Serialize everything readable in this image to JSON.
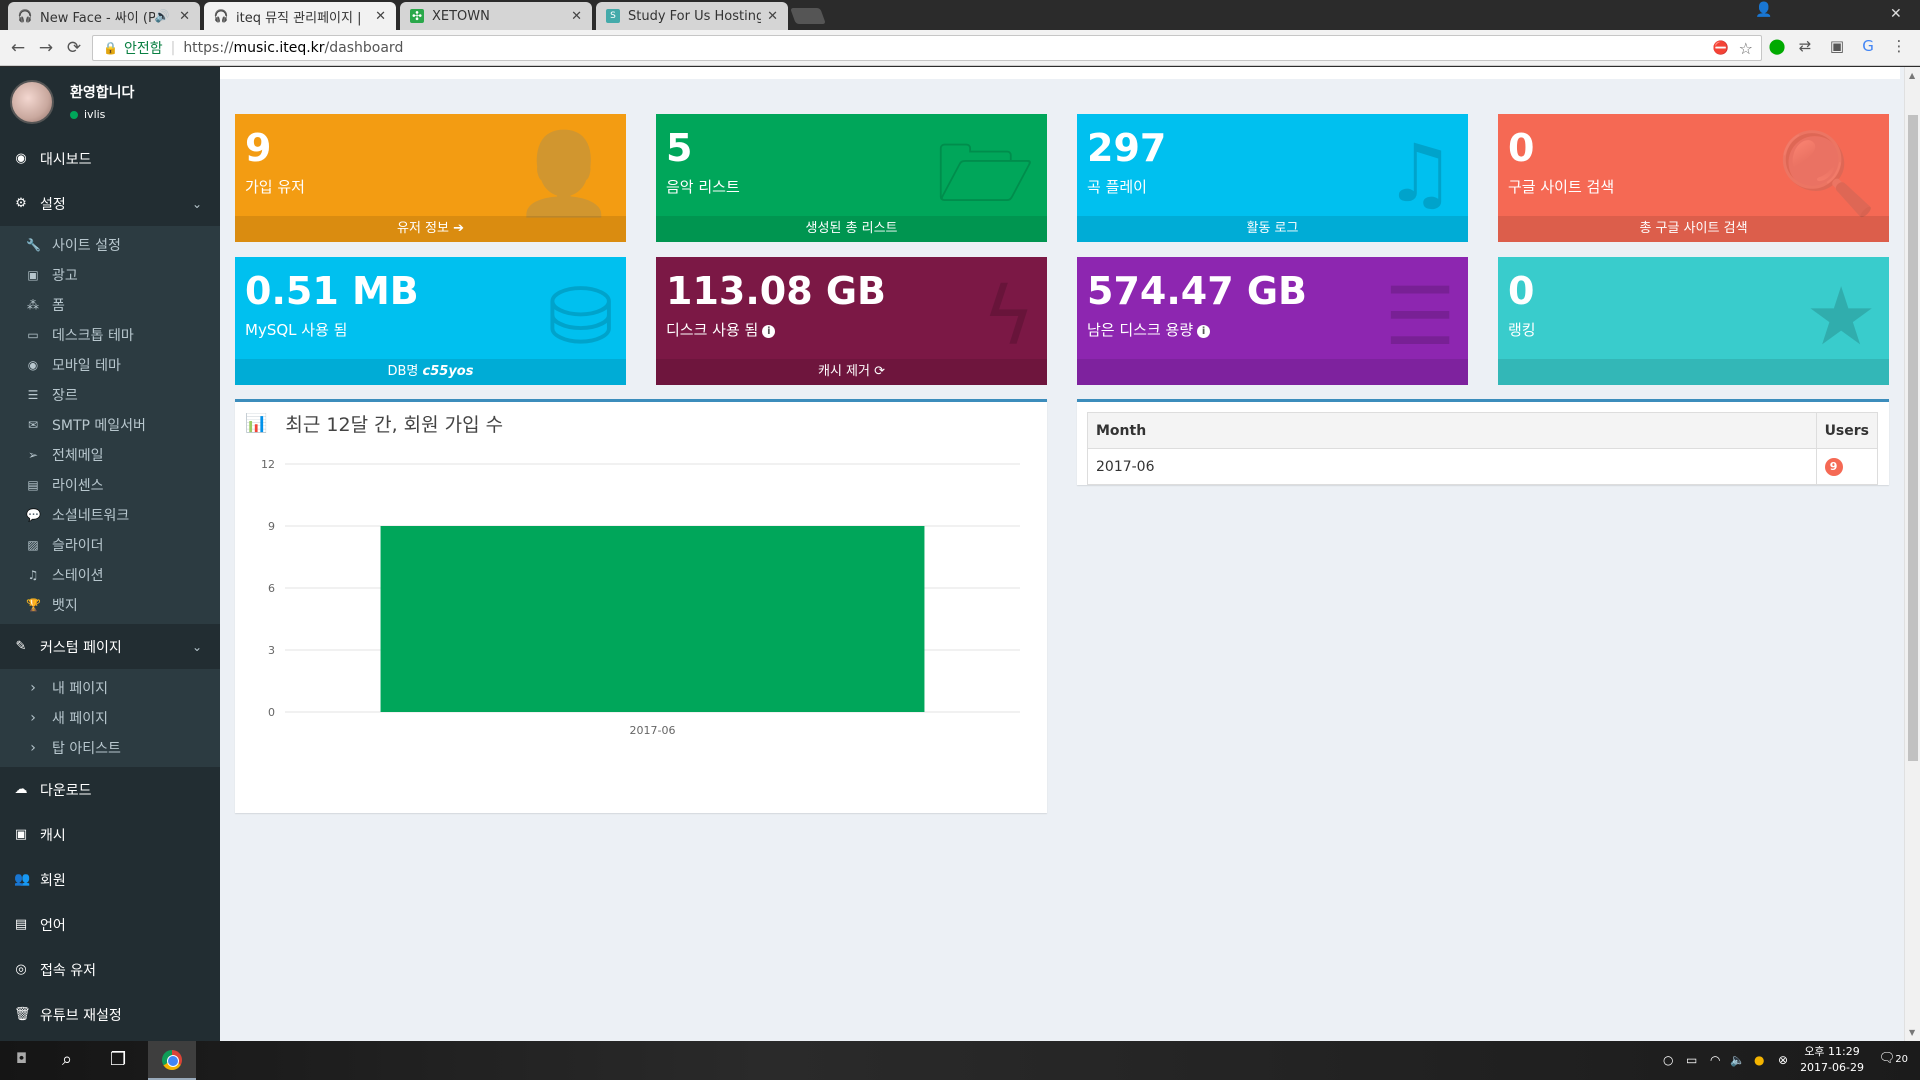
{
  "browser": {
    "tabs": [
      {
        "title": "New Face - 싸이 (PSY)",
        "icon": "headphones-icon"
      },
      {
        "title": "iteq 뮤직 관리페이지 |",
        "icon": "headphones-icon"
      },
      {
        "title": "XETOWN",
        "icon": "xetown-icon"
      },
      {
        "title": "Study For Us Hosting -",
        "icon": "hosting-icon"
      }
    ],
    "secure_label": "안전함",
    "url_scheme": "https://",
    "url_host": "music.iteq.kr",
    "url_path": "/dashboard"
  },
  "user": {
    "name": "환영합니다",
    "status": "ivlis"
  },
  "sidebar": {
    "dashboard": "대시보드",
    "settings": {
      "label": "설정",
      "items": [
        "사이트 설정",
        "광고",
        "폼",
        "데스크톱 테마",
        "모바일 테마",
        "장르",
        "SMTP 메일서버",
        "전체메일",
        "라이센스",
        "소셜네트워크",
        "슬라이더",
        "스테이션",
        "뱃지"
      ]
    },
    "custom_pages": {
      "label": "커스텀 페이지",
      "items": [
        "내 페이지",
        "새 페이지",
        "탑 아티스트"
      ]
    },
    "bottom_items": [
      "다운로드",
      "캐시",
      "회원",
      "언어",
      "접속 유저",
      "유튜브 재설정"
    ]
  },
  "stats": [
    {
      "value": "9",
      "label": "가입 유저",
      "footer": "유저 정보 ➔",
      "color": "#f39c12",
      "icon": "user-plus-icon"
    },
    {
      "value": "5",
      "label": "음악 리스트",
      "footer": "생성된 총 리스트",
      "color": "#00a65a",
      "icon": "folder-open-icon"
    },
    {
      "value": "297",
      "label": "곡 플레이",
      "footer": "활동 로그",
      "color": "#00c0ef",
      "icon": "music-icon"
    },
    {
      "value": "0",
      "label": "구글 사이트 검색",
      "footer": "총 구글 사이트 검색",
      "color": "#f56954",
      "icon": "search-icon"
    },
    {
      "value": "0.51 MB",
      "label": "MySQL 사용 됨",
      "footer_prefix": "DB명",
      "footer_em": "c55yos",
      "color": "#00c0ef",
      "icon": "database-icon"
    },
    {
      "value": "113.08 GB",
      "label": "디스크 사용 됨",
      "footer": "캐시 제거",
      "color": "#7b1845",
      "icon": "bolt-icon"
    },
    {
      "value": "574.47 GB",
      "label": "남은 디스크 용량",
      "footer": "",
      "color": "#8d26b0",
      "icon": "server-icon"
    },
    {
      "value": "0",
      "label": "랭킹",
      "footer": "",
      "color": "#39cccc",
      "icon": "star-icon"
    }
  ],
  "chart_panel": {
    "title": "최근 12달 간, 회원 가입 수"
  },
  "chart_data": {
    "type": "bar",
    "categories": [
      "2017-06"
    ],
    "values": [
      9
    ],
    "ylim": [
      0,
      12
    ],
    "yticks": [
      0,
      3,
      6,
      9,
      12
    ],
    "color": "#00a65a",
    "grid": true
  },
  "users_table": {
    "headers": [
      "Month",
      "Users"
    ],
    "rows": [
      {
        "month": "2017-06",
        "users": "9"
      }
    ]
  },
  "taskbar": {
    "clock_time": "오후 11:29",
    "clock_date": "2017-06-29",
    "notif_count": "20"
  }
}
